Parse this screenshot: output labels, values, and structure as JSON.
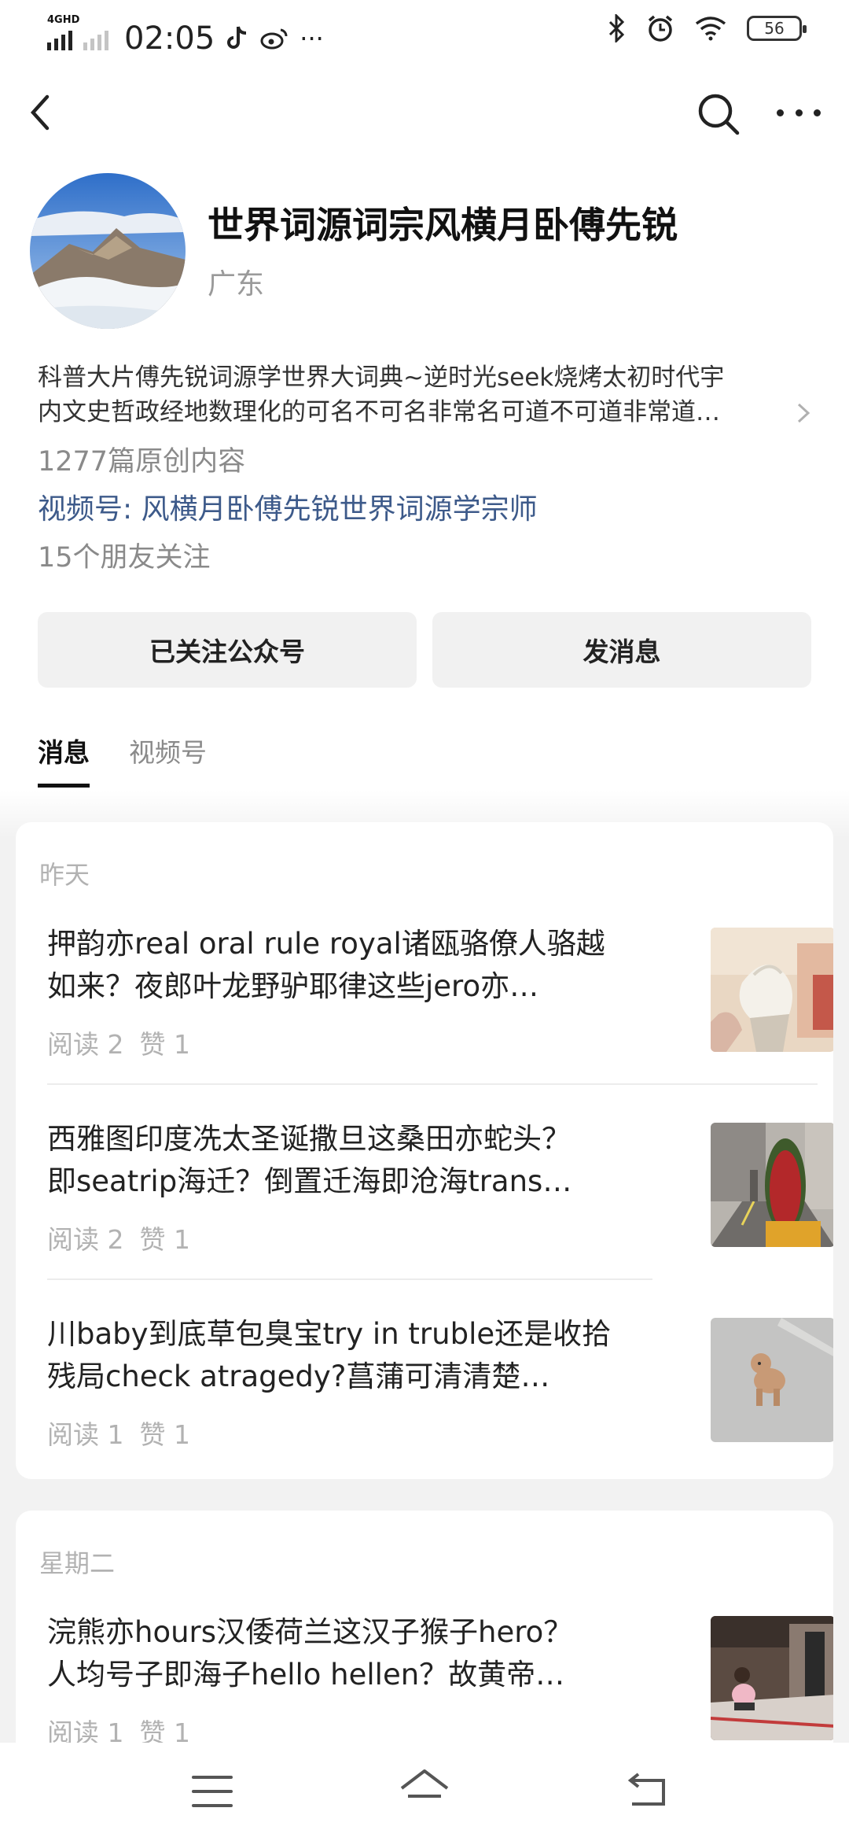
{
  "status_bar": {
    "network": "4GHD",
    "time": "02:05",
    "battery": "56",
    "more": "···"
  },
  "profile": {
    "name": "世界词源词宗风横月卧傅先锐",
    "region": "广东",
    "description_line1": "科普大片傅先锐词源学世界大词典~逆时光seek烧烤太初时代宇",
    "description_line2": "内文史哲政经地数理化的可名不可名非常名可道不可道非常道…",
    "original_count": "1277篇原创内容",
    "video_label": "视频号:",
    "video_name": "风横月卧傅先锐世界词源学宗师",
    "friends_following": "15个朋友关注"
  },
  "actions": {
    "followed_label": "已关注公众号",
    "message_label": "发消息"
  },
  "tabs": [
    {
      "label": "消息",
      "active": true
    },
    {
      "label": "视频号",
      "active": false
    }
  ],
  "groups": [
    {
      "day": "昨天",
      "articles": [
        {
          "title_line1": "押韵亦real oral rule royal诸瓯骆僚人骆越",
          "title_line2": "如来？夜郎叶龙野驴耶律这些jero亦…",
          "reads": "阅读 2",
          "likes": "赞 1",
          "thumb_icon": "soft-serve-ice-cream-photo"
        },
        {
          "title_line1": "西雅图印度冼太圣诞撒旦这桑田亦蛇头？",
          "title_line2": "即seatrip海迁？倒置迁海即沧海trans…",
          "reads": "阅读 2",
          "likes": "赞 1",
          "thumb_icon": "flower-tower-street-photo"
        },
        {
          "title_line1": "川baby到底草包臭宝try in truble还是收拾",
          "title_line2": "残局check atragedy?菖蒲可清清楚…",
          "reads": "阅读 1",
          "likes": "赞 1",
          "thumb_icon": "poodle-dog-photo"
        }
      ]
    },
    {
      "day": "星期二",
      "articles": [
        {
          "title_line1": "浣熊亦hours汉倭荷兰这汉子猴子hero？",
          "title_line2": "人均号子即海子hello hellen？故黄帝…",
          "reads": "阅读 1",
          "likes": "赞 1",
          "thumb_icon": "child-in-shop-photo"
        }
      ]
    }
  ]
}
